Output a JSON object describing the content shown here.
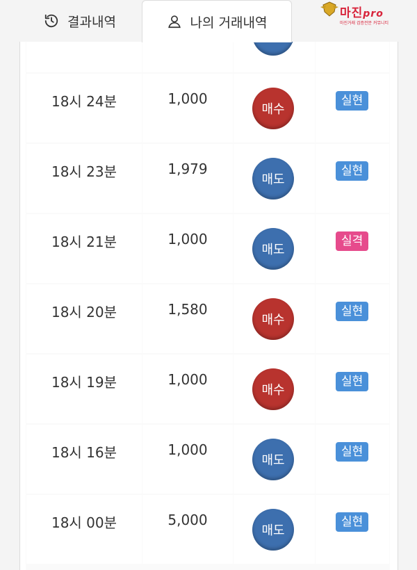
{
  "tabs": {
    "results_label": "결과내역",
    "mytrades_label": "나의 거래내역"
  },
  "logo": {
    "main": "마진",
    "accent": "pro",
    "sub": "마진거래 검증전문 커뮤니티"
  },
  "colors": {
    "sell": "#3d6fae",
    "buy": "#b8332e",
    "hit": "#4a90d9",
    "miss": "#e64b8c"
  },
  "partial_row": {
    "side": "매도",
    "side_type": "sell"
  },
  "rows": [
    {
      "time": "18시 24분",
      "amount": "1,000",
      "side": "매수",
      "side_type": "buy",
      "result": "실현",
      "result_type": "hit"
    },
    {
      "time": "18시 23분",
      "amount": "1,979",
      "side": "매도",
      "side_type": "sell",
      "result": "실현",
      "result_type": "hit"
    },
    {
      "time": "18시 21분",
      "amount": "1,000",
      "side": "매도",
      "side_type": "sell",
      "result": "실격",
      "result_type": "miss"
    },
    {
      "time": "18시 20분",
      "amount": "1,580",
      "side": "매수",
      "side_type": "buy",
      "result": "실현",
      "result_type": "hit"
    },
    {
      "time": "18시 19분",
      "amount": "1,000",
      "side": "매수",
      "side_type": "buy",
      "result": "실현",
      "result_type": "hit"
    },
    {
      "time": "18시 16분",
      "amount": "1,000",
      "side": "매도",
      "side_type": "sell",
      "result": "실현",
      "result_type": "hit"
    },
    {
      "time": "18시 00분",
      "amount": "5,000",
      "side": "매도",
      "side_type": "sell",
      "result": "실현",
      "result_type": "hit"
    }
  ]
}
